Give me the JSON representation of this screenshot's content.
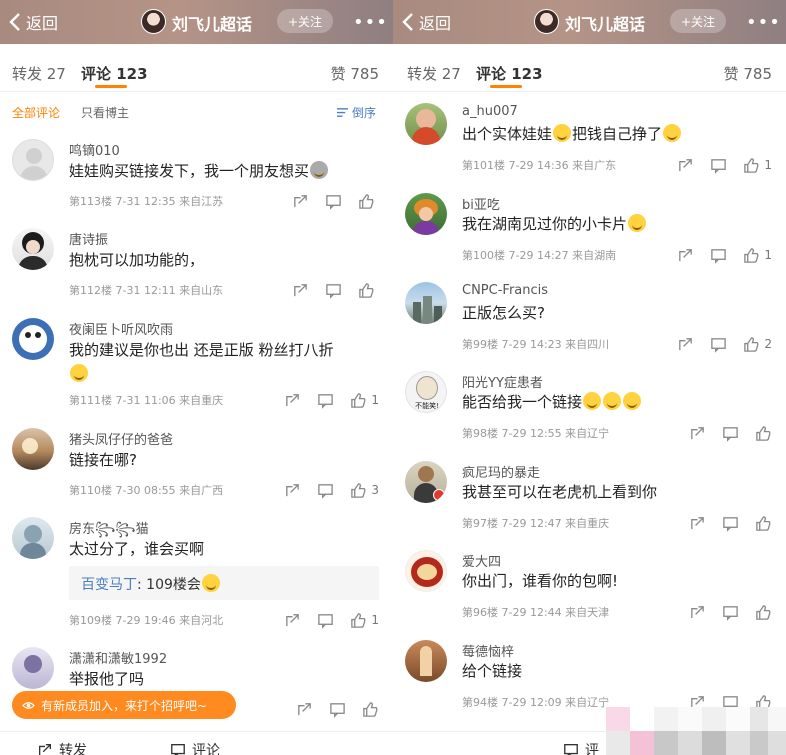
{
  "header": {
    "back_label": "返回",
    "title": "刘飞儿超话",
    "follow_label": "+关注",
    "more": "•••"
  },
  "tabs": {
    "repost": "转发 27",
    "comments": "评论 123",
    "likes": "赞 785"
  },
  "filter": {
    "all": "全部评论",
    "owner_only": "只看博主",
    "sort": "倒序"
  },
  "left_comments": [
    {
      "name": "鸣镝010",
      "text": "娃娃购买链接发下，我一个朋友想买",
      "emoji_count": 1,
      "meta": "第113楼 7-31 12:35 来自江苏",
      "likes": ""
    },
    {
      "name": "唐诗振",
      "text": "抱枕可以加功能的，",
      "emoji_count": 0,
      "meta": "第112楼 7-31 12:11 来自山东",
      "likes": ""
    },
    {
      "name": "夜阑臣卜听风吹雨",
      "text": "我的建议是你也出 还是正版 粉丝打八折",
      "emoji_count": 1,
      "meta": "第111楼 7-31 11:06 来自重庆",
      "likes": "1"
    },
    {
      "name": "猪头凤仔仔的爸爸",
      "text": "链接在哪?",
      "emoji_count": 0,
      "meta": "第110楼 7-30 08:55 来自广西",
      "likes": "3"
    },
    {
      "name": "房东꧂꧂猫",
      "text": "太过分了，谁会买啊",
      "emoji_count": 0,
      "meta": "第109楼 7-29 19:46 来自河北",
      "likes": "1",
      "reply": {
        "name": "百变马丁",
        "text": ": 109楼会"
      }
    },
    {
      "name": "潇潇和潇敏1992",
      "text": "举报他了吗",
      "emoji_count": 0,
      "meta": "",
      "likes": ""
    }
  ],
  "right_comments": [
    {
      "name": "a_hu007",
      "text": "出个实体娃娃",
      "text2": "把钱自己挣了",
      "emoji_count": 1,
      "meta": "第101楼 7-29 14:36 来自广东",
      "likes": "1"
    },
    {
      "name": "bi亚吃",
      "text": "我在湖南见过你的小卡片",
      "emoji_count": 1,
      "meta": "第100楼 7-29 14:27 来自湖南",
      "likes": "1"
    },
    {
      "name": "CNPC-Francis",
      "text": "正版怎么买?",
      "emoji_count": 0,
      "meta": "第99楼 7-29 14:23 来自四川",
      "likes": "2"
    },
    {
      "name": "阳光YY症患者",
      "text": "能否给我一个链接",
      "emoji_count": 3,
      "meta": "第98楼 7-29 12:55 来自辽宁",
      "likes": "",
      "avatar_text": "不能笑!"
    },
    {
      "name": "疯尼玛的暴走",
      "text": "我甚至可以在老虎机上看到你",
      "emoji_count": 0,
      "meta": "第97楼 7-29 12:47 来自重庆",
      "likes": ""
    },
    {
      "name": "爱大四",
      "text": "你出门，谁看你的包啊!",
      "emoji_count": 0,
      "meta": "第96楼 7-29 12:44 来自天津",
      "likes": ""
    },
    {
      "name": "莓德恼梓",
      "text": "给个链接",
      "emoji_count": 0,
      "meta": "第94楼 7-29 12:09 来自辽宁",
      "likes": ""
    }
  ],
  "toast": {
    "text": "有新成员加入，来打个招呼吧~"
  },
  "bottombar": {
    "repost": "转发",
    "comment": "评论",
    "comment_right": "评"
  },
  "colors": {
    "accent": "#ff8200",
    "toast": "#ff8a1f",
    "link": "#4a7dc4"
  }
}
